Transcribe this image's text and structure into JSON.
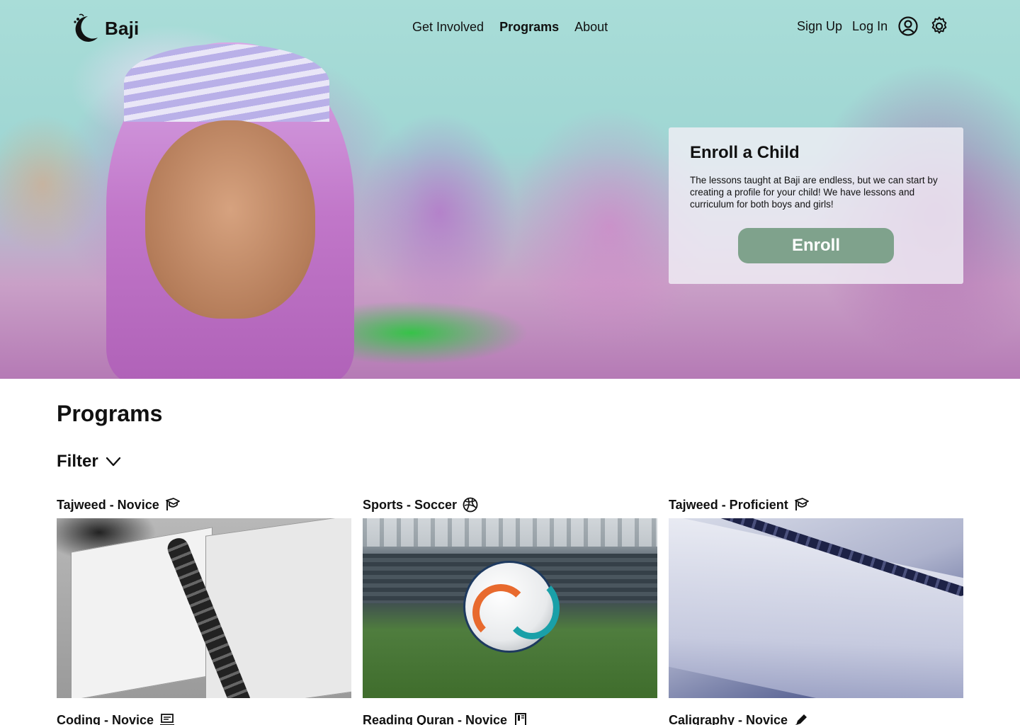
{
  "brand": {
    "name": "Baji"
  },
  "nav": {
    "links": [
      {
        "label": "Get Involved",
        "active": false
      },
      {
        "label": "Programs",
        "active": true
      },
      {
        "label": "About",
        "active": false
      }
    ],
    "sign_up": "Sign Up",
    "log_in": "Log In",
    "icons": [
      "user-circle-icon",
      "gear-icon"
    ]
  },
  "enroll": {
    "title": "Enroll a Child",
    "text": "The lessons taught at Baji are endless, but we can start by creating a profile for your child! We have lessons and curriculum for both boys and girls!",
    "button": "Enroll",
    "button_color": "#7fa28c"
  },
  "programs": {
    "title": "Programs",
    "filter_label": "Filter",
    "cards": [
      {
        "title": "Tajweed - Novice",
        "icon": "graduation-cap-icon"
      },
      {
        "title": "Sports - Soccer",
        "icon": "soccer-ball-icon"
      },
      {
        "title": "Tajweed - Proficient",
        "icon": "graduation-cap-icon"
      },
      {
        "title": "Coding - Novice",
        "icon": "laptop-icon"
      },
      {
        "title": "Reading Quran - Novice",
        "icon": "book-icon"
      },
      {
        "title": "Caligraphy - Novice",
        "icon": "pen-icon"
      }
    ]
  }
}
